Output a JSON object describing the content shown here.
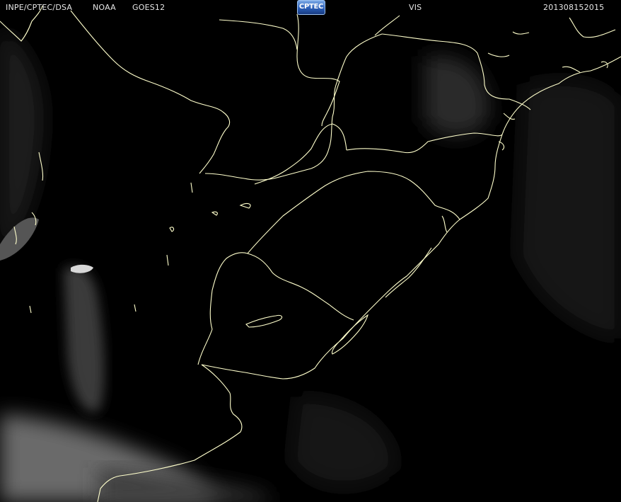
{
  "header": {
    "agency": "INPE/CPTEC/DSA",
    "noaa": "NOAA",
    "satellite": "GOES12",
    "channel": "VIS",
    "timestamp": "201308152015"
  },
  "logo": {
    "text": "CPTEC"
  },
  "colors": {
    "background": "#000000",
    "coastline": "#ffffcc",
    "header_text": "#e6e6e6",
    "cloud_gray": "#5a5a5a"
  }
}
